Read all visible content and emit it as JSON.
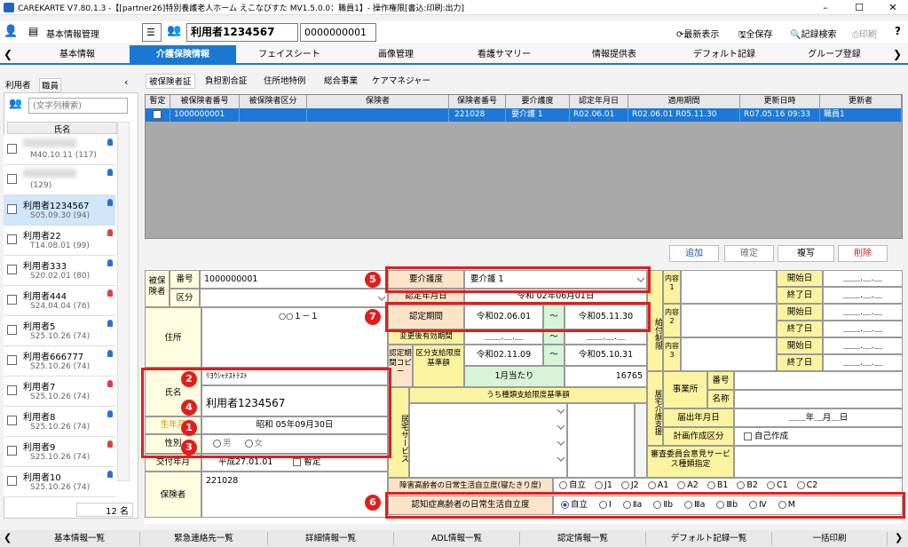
{
  "window": {
    "title": "CAREKARTE V7.80.1.3 -【[partner26]特別養護老人ホーム えこなびすた MV1.5.0.0：職員1】- 操作権限[書込:印刷:出力]"
  },
  "toolbar": {
    "section": "基本情報管理",
    "user_name": "利用者1234567",
    "user_id": "0000000001",
    "refresh": "最新表示",
    "save_all": "全保存",
    "record_search": "記録検索",
    "print": "印刷",
    "help": "?"
  },
  "main_tabs": [
    "基本情報",
    "介護保険情報",
    "フェイスシート",
    "画像管理",
    "看護サマリー",
    "情報提供表",
    "デフォルト記録",
    "グループ登録"
  ],
  "left_panel": {
    "tab_user": "利用者",
    "tab_staff": "職員",
    "search_placeholder": "(文字列検索)",
    "col_name": "氏名",
    "count": "12 名",
    "users": [
      {
        "name": "",
        "date": "M40.10.11 (117)",
        "color": "#2a6fd6"
      },
      {
        "name": "",
        "date": "(129)",
        "color": "#2a6fd6"
      },
      {
        "name": "利用者1234567",
        "date": "S05.09.30 (94)",
        "color": "#2a6fd6"
      },
      {
        "name": "利用者22",
        "date": "T14.08.01 (99)",
        "color": "#e04040"
      },
      {
        "name": "利用者333",
        "date": "S20.02.01 (80)",
        "color": "#2a6fd6"
      },
      {
        "name": "利用者444",
        "date": "S24.04.04 (76)",
        "color": "#e04040"
      },
      {
        "name": "利用者5",
        "date": "S25.10.26 (74)",
        "color": "#2a6fd6"
      },
      {
        "name": "利用者666777",
        "date": "S25.10.26 (74)",
        "color": "#2a6fd6"
      },
      {
        "name": "利用者7",
        "date": "S25.10.26 (74)",
        "color": "#e04040"
      },
      {
        "name": "利用者8",
        "date": "S25.10.26 (74)",
        "color": "#2a6fd6"
      },
      {
        "name": "利用者9",
        "date": "S25.10.26 (74)",
        "color": "#e04040"
      },
      {
        "name": "利用者10",
        "date": "S25.10.26 (74)",
        "color": "#2a6fd6"
      }
    ]
  },
  "sub_tabs": [
    "被保険者証",
    "負担割合証",
    "住所地特例",
    "総合事業",
    "ケアマネジャー"
  ],
  "grid": {
    "headers": [
      "暫定",
      "被保険者番号",
      "被保険者区分",
      "保険者",
      "保険者番号",
      "要介護度",
      "認定年月日",
      "適用期間",
      "更新日時",
      "更新者"
    ],
    "row": [
      "",
      "1000000001",
      "",
      "",
      "221028",
      "要介護 1",
      "R02.06.01",
      "R02.06.01 R05.11.30",
      "R07.05.16 09:33",
      "職員1"
    ]
  },
  "actions": {
    "add": "追加",
    "confirm": "確定",
    "copy": "複写",
    "delete": "削除"
  },
  "form": {
    "insured": "被保険者",
    "number_lbl": "番号",
    "number": "1000000001",
    "kubun_lbl": "区分",
    "address_lbl": "住所",
    "address": "○○１－１",
    "name_lbl": "氏名",
    "kana": "ﾘﾖｳｼｬﾃｽﾄﾃｽﾄ",
    "name": "利用者1234567",
    "birth_lbl": "生年月",
    "birth": "昭和 05年09月30日",
    "sex_lbl": "性別",
    "sex_m": "男",
    "sex_f": "女",
    "issue_lbl": "交付年月",
    "issue": "平成27.01.01",
    "provisional": "暫定",
    "insurer_lbl": "保険者",
    "insurer": "221028",
    "care_lbl": "要介護度",
    "care": "要介護 1",
    "cert_date_lbl": "認定年月日",
    "cert_date": "令和 02年06月01日",
    "period_lbl": "認定期間",
    "period_from": "令和02.06.01",
    "period_to": "令和05.11.30",
    "tilde": "～",
    "changed_lbl": "変更後有効期間",
    "blank_date": "＿＿.＿.＿",
    "copy_lbl": "認定期間コピー",
    "limit_lbl": "区分支給限度基準額",
    "limit_from": "令和02.11.09",
    "limit_to": "令和05.10.31",
    "per_month": "1月当たり",
    "limit_amount": "16765",
    "kind_lbl": "うち種類支給限度基準額",
    "home_service": "居宅サービス",
    "benefit_lbl": "給付制限",
    "content1": "内容1",
    "content2": "内容2",
    "content3": "内容3",
    "start": "開始日",
    "end": "終了日",
    "support_lbl": "居宅介護支援",
    "office_lbl": "事業所",
    "num_lbl": "番号",
    "nm_lbl": "名称",
    "notify_lbl": "届出年月日",
    "notify_date": "＿＿年＿月＿日",
    "plan_lbl": "計画作成区分",
    "self_made": "自己作成",
    "opinion_lbl": "審査委員会意見サービス種類指定",
    "disabled_lbl": "障害高齢者の日常生活自立度(寝たきり度)",
    "disabled_opts": [
      "自立",
      "J1",
      "J2",
      "A1",
      "A2",
      "B1",
      "B2",
      "C1",
      "C2"
    ],
    "dementia_lbl": "認知症高齢者の日常生活自立度",
    "dementia_opts": [
      "自立",
      "Ⅰ",
      "Ⅱa",
      "Ⅱb",
      "Ⅲa",
      "Ⅲb",
      "Ⅳ",
      "M"
    ]
  },
  "markers": [
    "1",
    "2",
    "3",
    "4",
    "5",
    "6",
    "7"
  ],
  "bottom": [
    "基本情報一覧",
    "緊急連絡先一覧",
    "詳細情報一覧",
    "ADL情報一覧",
    "認定情報一覧",
    "デフォルト記録一覧",
    "一括印刷"
  ]
}
